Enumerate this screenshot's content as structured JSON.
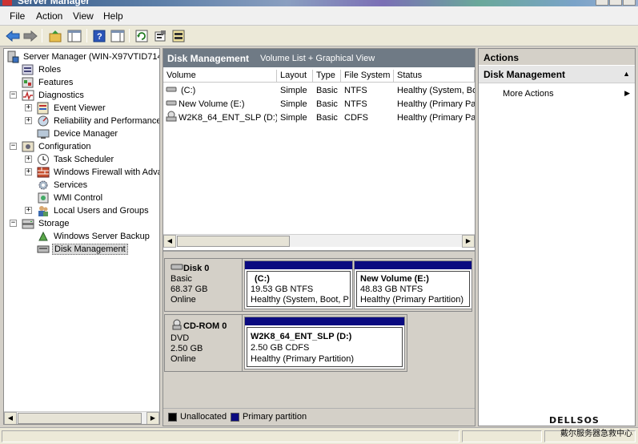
{
  "window": {
    "title": "Server Manager"
  },
  "menu": [
    "File",
    "Action",
    "View",
    "Help"
  ],
  "tree": {
    "root": "Server Manager (WIN-X97VTID714",
    "roles": "Roles",
    "features": "Features",
    "diagnostics": "Diagnostics",
    "event_viewer": "Event Viewer",
    "reliability": "Reliability and Performance",
    "device_manager": "Device Manager",
    "configuration": "Configuration",
    "task_scheduler": "Task Scheduler",
    "firewall": "Windows Firewall with Adva",
    "services": "Services",
    "wmi": "WMI Control",
    "local_users": "Local Users and Groups",
    "storage": "Storage",
    "backup": "Windows Server Backup",
    "disk_mgmt": "Disk Management"
  },
  "center": {
    "title": "Disk Management",
    "subtitle": "Volume List + Graphical View",
    "columns": [
      "Volume",
      "Layout",
      "Type",
      "File System",
      "Status"
    ],
    "rows": [
      {
        "volume": "(C:)",
        "layout": "Simple",
        "type": "Basic",
        "fs": "NTFS",
        "status": "Healthy (System, Bo"
      },
      {
        "volume": "New Volume (E:)",
        "layout": "Simple",
        "type": "Basic",
        "fs": "NTFS",
        "status": "Healthy (Primary Pa"
      },
      {
        "volume": "W2K8_64_ENT_SLP (D:)",
        "layout": "Simple",
        "type": "Basic",
        "fs": "CDFS",
        "status": "Healthy (Primary Pa"
      }
    ],
    "disks": {
      "disk0": {
        "name": "Disk 0",
        "type": "Basic",
        "size": "68.37 GB",
        "state": "Online"
      },
      "cdrom0": {
        "name": "CD-ROM 0",
        "type": "DVD",
        "size": "2.50 GB",
        "state": "Online"
      }
    },
    "partitions": {
      "c": {
        "name": "(C:)",
        "size": "19.53 GB NTFS",
        "status": "Healthy (System, Boot, P"
      },
      "e": {
        "name": "New Volume  (E:)",
        "size": "48.83 GB NTFS",
        "status": "Healthy (Primary Partition)"
      },
      "d": {
        "name": "W2K8_64_ENT_SLP  (D:)",
        "size": "2.50 GB CDFS",
        "status": "Healthy (Primary Partition)"
      }
    },
    "legend": {
      "unallocated": "Unallocated",
      "primary": "Primary partition",
      "unallocated_color": "#000000",
      "primary_color": "#0a0a80"
    }
  },
  "actions": {
    "title": "Actions",
    "section": "Disk Management",
    "more": "More Actions"
  },
  "watermark": {
    "brand": "DELLSOS",
    "sub": "戴尔服务器急救中心"
  }
}
